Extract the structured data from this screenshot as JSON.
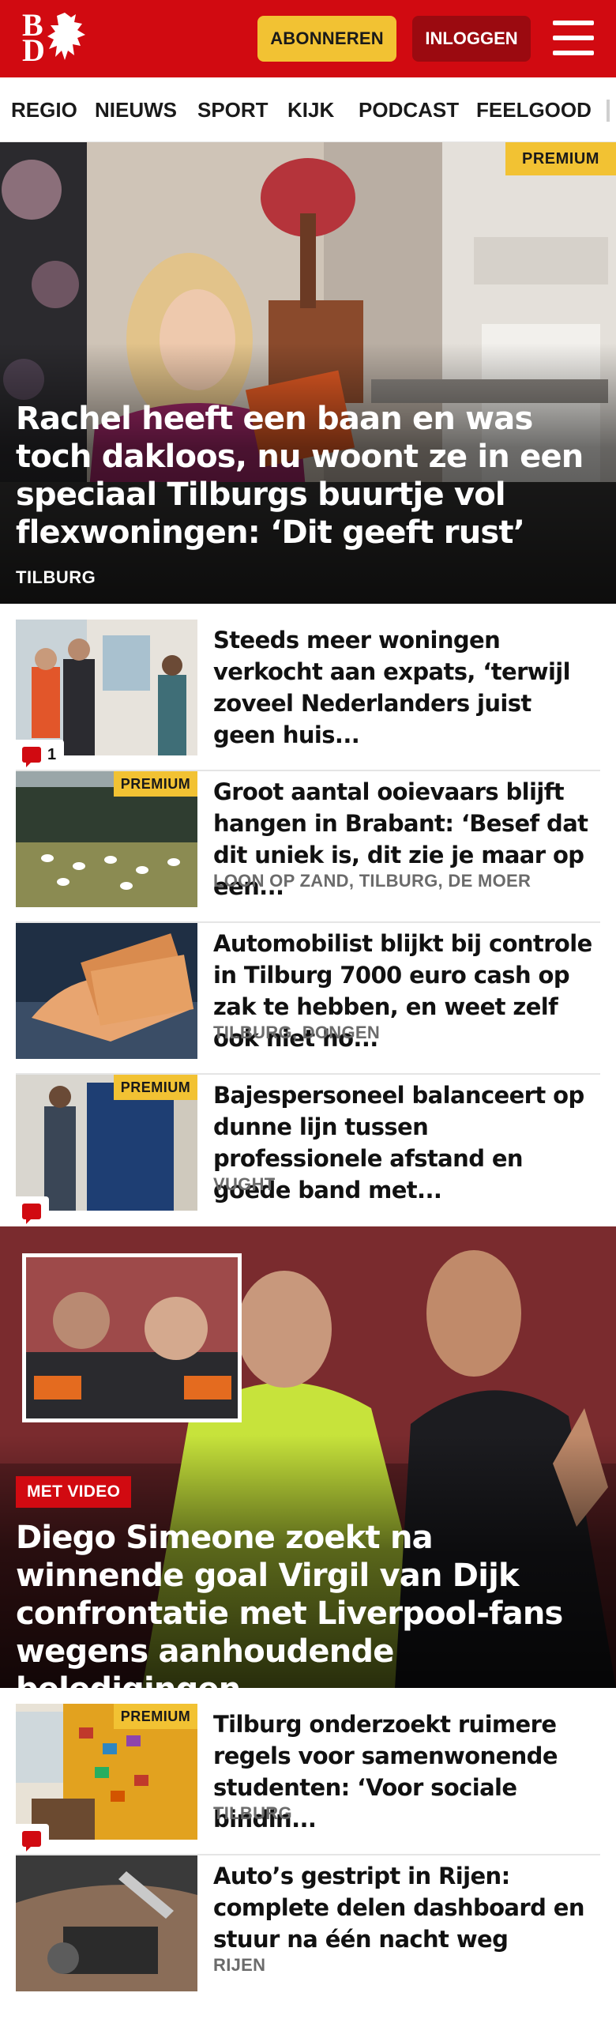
{
  "header": {
    "logo_line1": "B",
    "logo_line2": "D",
    "subscribe_label": "ABONNEREN",
    "login_label": "INLOGGEN",
    "brand_color": "#d10a11",
    "accent_color": "#f2c233"
  },
  "nav": {
    "items": [
      {
        "label": "REGIO"
      },
      {
        "label": "NIEUWS"
      },
      {
        "label": "SPORT"
      },
      {
        "label": "KIJK"
      },
      {
        "label": "PODCAST"
      },
      {
        "label": "FEELGOOD"
      }
    ]
  },
  "hero": {
    "badge": "PREMIUM",
    "title": "Rachel heeft een baan en was toch dakloos, nu woont ze in een speciaal Tilburgs buurtje vol flexwoningen: ‘Dit geeft rust’",
    "location": "TILBURG"
  },
  "articles_top": [
    {
      "title": "Steeds meer woningen verkocht aan expats, ‘terwijl zoveel Nederlanders juist geen huis...",
      "location": "",
      "premium": false,
      "comments": "1"
    },
    {
      "title": "Groot aantal ooievaars blijft hangen in Brabant: ‘Besef dat dit uniek is, dit zie je maar op een...",
      "location": "LOON OP ZAND, TILBURG, DE MOER",
      "premium": true,
      "comments": ""
    },
    {
      "title": "Automobilist blijkt bij controle in Tilburg 7000 euro cash op zak te hebben, en weet zelf ook niet ho...",
      "location": "TILBURG, DONGEN",
      "premium": false,
      "comments": ""
    },
    {
      "title": "Bajespersoneel balanceert op dunne lijn tussen professionele afstand en goede band met...",
      "location": "VUGHT",
      "premium": true,
      "comments": ""
    }
  ],
  "premium_label": "PREMIUM",
  "video": {
    "badge": "MET VIDEO",
    "title": "Diego Simeone zoekt na winnende goal Virgil van Dijk confrontatie met Liverpool-fans wegens aanhoudende beledigingen"
  },
  "articles_bottom": [
    {
      "title": "Tilburg onderzoekt ruimere regels voor samenwonende studenten: ‘Voor sociale bindin...",
      "location": "TILBURG",
      "premium": true
    },
    {
      "title": "Auto’s gestript in Rijen: complete delen dashboard en stuur na één nacht weg",
      "location": "RIJEN",
      "premium": false
    }
  ]
}
